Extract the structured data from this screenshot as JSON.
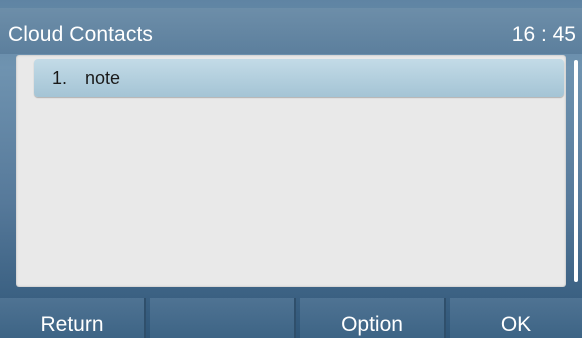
{
  "header": {
    "title": "Cloud Contacts",
    "time": "16 : 45"
  },
  "list": {
    "items": [
      {
        "index": "1.",
        "label": "note",
        "selected": true
      }
    ]
  },
  "softkeys": {
    "key1": "Return",
    "key2": "",
    "key3": "Option",
    "key4": "OK"
  },
  "colors": {
    "title_bar": "#6d8ea9",
    "list_background": "#e9e9e9",
    "selected_item": "#b3d0de",
    "softkey": "#4a6e8e"
  }
}
